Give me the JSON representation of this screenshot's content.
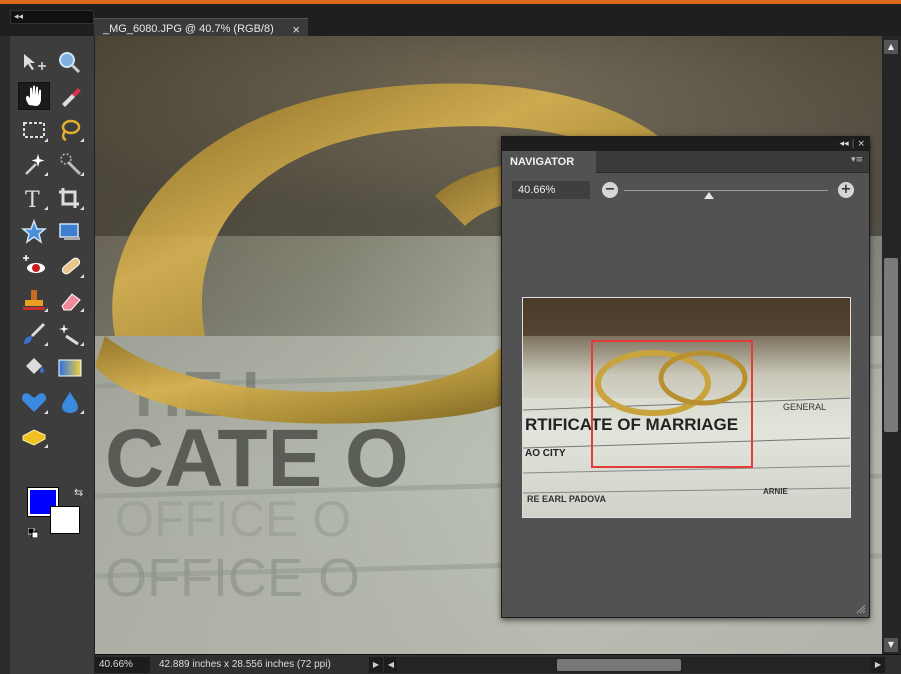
{
  "document": {
    "tab_title": "_MG_6080.JPG @ 40.7% (RGB/8)",
    "tab_close": "×"
  },
  "toolbar": {
    "collapse_label": "◂◂",
    "tools": [
      "move-tool-icon",
      "zoom-tool-icon",
      "hand-tool-icon",
      "eyedropper-tool-icon",
      "marquee-tool-icon",
      "lasso-tool-icon",
      "magic-wand-tool-icon",
      "quick-selection-tool-icon",
      "type-tool-icon",
      "crop-tool-icon",
      "cookie-cutter-tool-icon",
      "straighten-tool-icon",
      "red-eye-tool-icon",
      "healing-brush-tool-icon",
      "clone-stamp-tool-icon",
      "eraser-tool-icon",
      "brush-tool-icon",
      "smart-brush-tool-icon",
      "paint-bucket-tool-icon",
      "gradient-tool-icon",
      "custom-shape-tool-icon",
      "blur-tool-icon",
      "sponge-tool-icon"
    ],
    "active_tool": "hand-tool-icon",
    "foreground_color": "#0000ff",
    "background_color": "#ffffff"
  },
  "navigator": {
    "title": "NAVIGATOR",
    "collapse_label": "◂◂",
    "close_label": "×",
    "zoom_value": "40.66%",
    "zoom_level": 0.4066,
    "thumbnail_text": {
      "line1": "RTIFICATE OF MARRIAGE",
      "line2": "GENERAL",
      "line3": "AO CITY",
      "line4": "RE EARL PADOVA",
      "line5": "ARNIE"
    }
  },
  "status": {
    "zoom": "40.66%",
    "doc_info": "42.889 inches x 28.556 inches (72 ppi)"
  },
  "photo_text": {
    "line1": "CATE O",
    "line2": "OFFICE O",
    "line3": "OFFICE O",
    "line4": "HE I"
  },
  "colors": {
    "accent": "#d86b1a",
    "view_rect": "#e63b3b"
  }
}
